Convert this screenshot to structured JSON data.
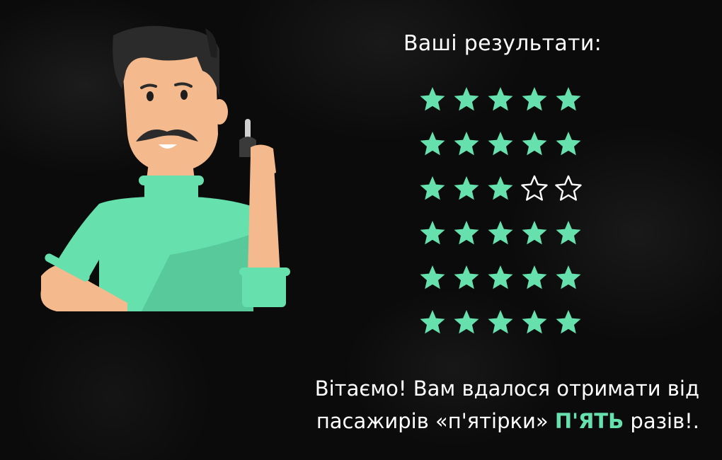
{
  "results": {
    "title": "Ваші результати:",
    "star_color": "#66e0ad",
    "empty_star_color": "#ffffff",
    "ratings": [
      5,
      5,
      3,
      5,
      5,
      5
    ],
    "max_stars": 5
  },
  "message": {
    "line1": "Вітаємо! Вам вдалося отримати від",
    "line2_prefix": "пасажирів «п'ятірки»",
    "highlight": "П'ЯТЬ",
    "line2_suffix": "разів!."
  },
  "character": {
    "icon": "driver-holding-key-icon",
    "shirt_color": "#66e0ad",
    "skin_color": "#f4b98c",
    "hair_color": "#2b2b2b"
  }
}
